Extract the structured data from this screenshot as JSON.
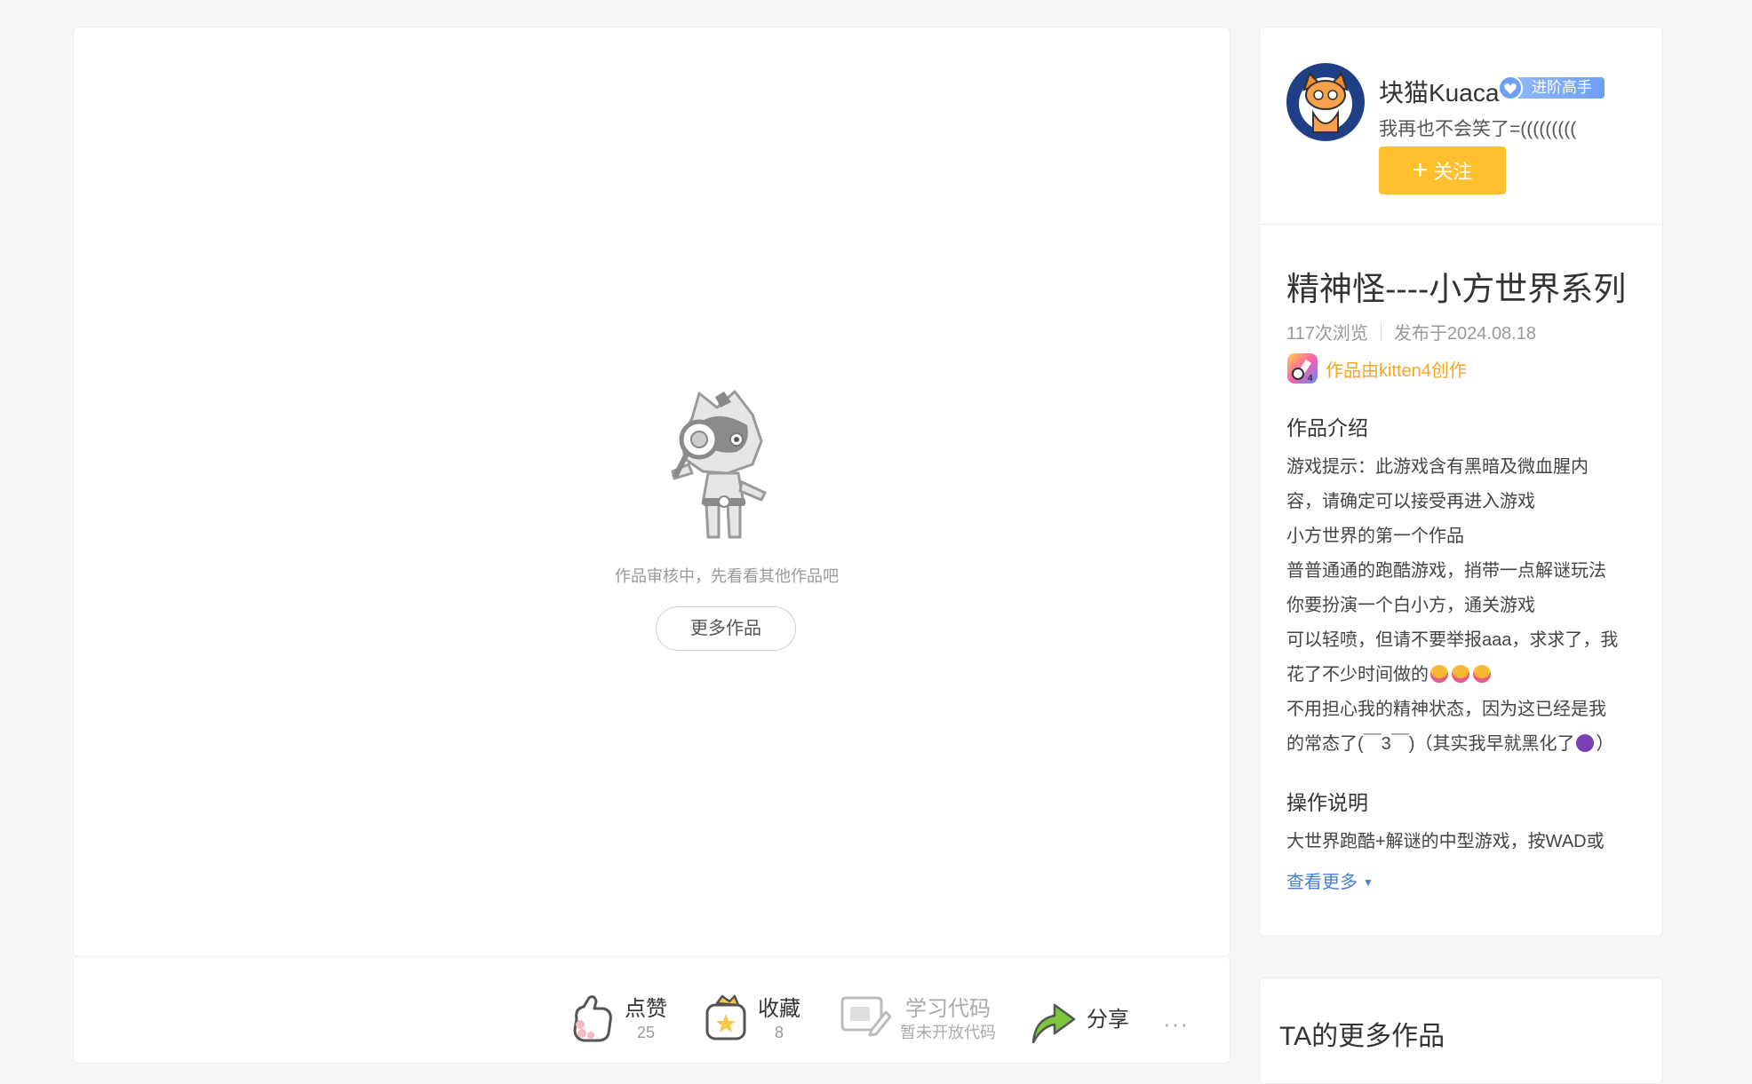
{
  "player": {
    "empty_message": "作品审核中，先看看其他作品吧",
    "more_works_button": "更多作品"
  },
  "toolbar": {
    "like": {
      "label": "点赞",
      "count": "25"
    },
    "collect": {
      "label": "收藏",
      "count": "8"
    },
    "code": {
      "label": "学习代码",
      "sub": "暂未开放代码"
    },
    "share": {
      "label": "分享"
    },
    "more": "···"
  },
  "author": {
    "name": "块猫Kuaca",
    "badge": "进阶高手",
    "bio": "我再也不会笑了=(((((((((",
    "follow_label": "关注"
  },
  "work": {
    "title": "精神怪----小方世界系列",
    "views": "117次浏览",
    "published": "发布于2024.08.18",
    "creator": "作品由kitten4创作",
    "intro_heading": "作品介绍",
    "intro_lines": [
      "游戏提示：此游戏含有黑暗及微血腥内",
      "容，请确定可以接受再进入游戏",
      "小方世界的第一个作品",
      "普普通通的跑酷游戏，捎带一点解谜玩法",
      "你要扮演一个白小方，通关游戏",
      "可以轻喷，但请不要举报aaa，求求了，我",
      "花了不少时间做的",
      "不用担心我的精神状态，因为这已经是我",
      "的常态了(￣3￣)（其实我早就黑化了",
      "）"
    ],
    "ops_heading": "操作说明",
    "ops_line": "大世界跑酷+解谜的中型游戏，按WAD或",
    "view_more": "查看更多"
  },
  "sidebar": {
    "more_works_title": "TA的更多作品"
  },
  "colors": {
    "accent_yellow": "#ffc02e",
    "link_blue": "#4a7fcf",
    "creator_orange": "#f5a623",
    "badge_blue": "#7aa8f8"
  }
}
